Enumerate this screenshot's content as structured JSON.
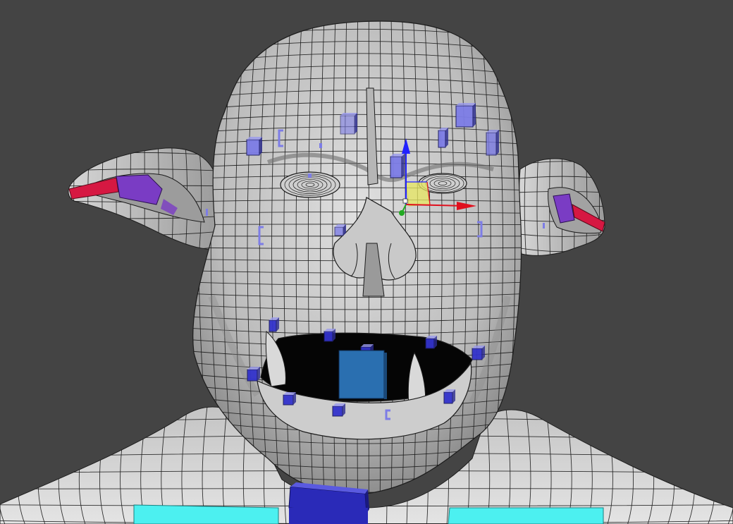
{
  "viewport": {
    "background_color": "#444444",
    "mesh_color": "#d2d2d2",
    "mesh_shadow_color": "#8a8a8a",
    "wire_color": "#1c1c1c"
  },
  "gizmo": {
    "x_axis_color": "#e0101e",
    "y_axis_color": "#2222ff",
    "z_axis_color": "#22aa22",
    "plane_color": "#e8e860"
  },
  "rig_controls": {
    "face_control_color": "#3333cc",
    "face_control_light_color": "#7d7de6",
    "ear_control_color": "#7a3cc4",
    "ear_tip_color": "#d61842",
    "jaw_control_color": "#2a6fb0",
    "neck_control_color": "#2a2ab8",
    "shoulder_control_color": "#4cf0f0",
    "icons": [
      "brow-control-icon",
      "cheek-control-icon",
      "lip-control-icon",
      "jaw-control-icon",
      "ear-control-icon",
      "neck-control-icon",
      "shoulder-control-icon",
      "move-gizmo-icon"
    ]
  }
}
